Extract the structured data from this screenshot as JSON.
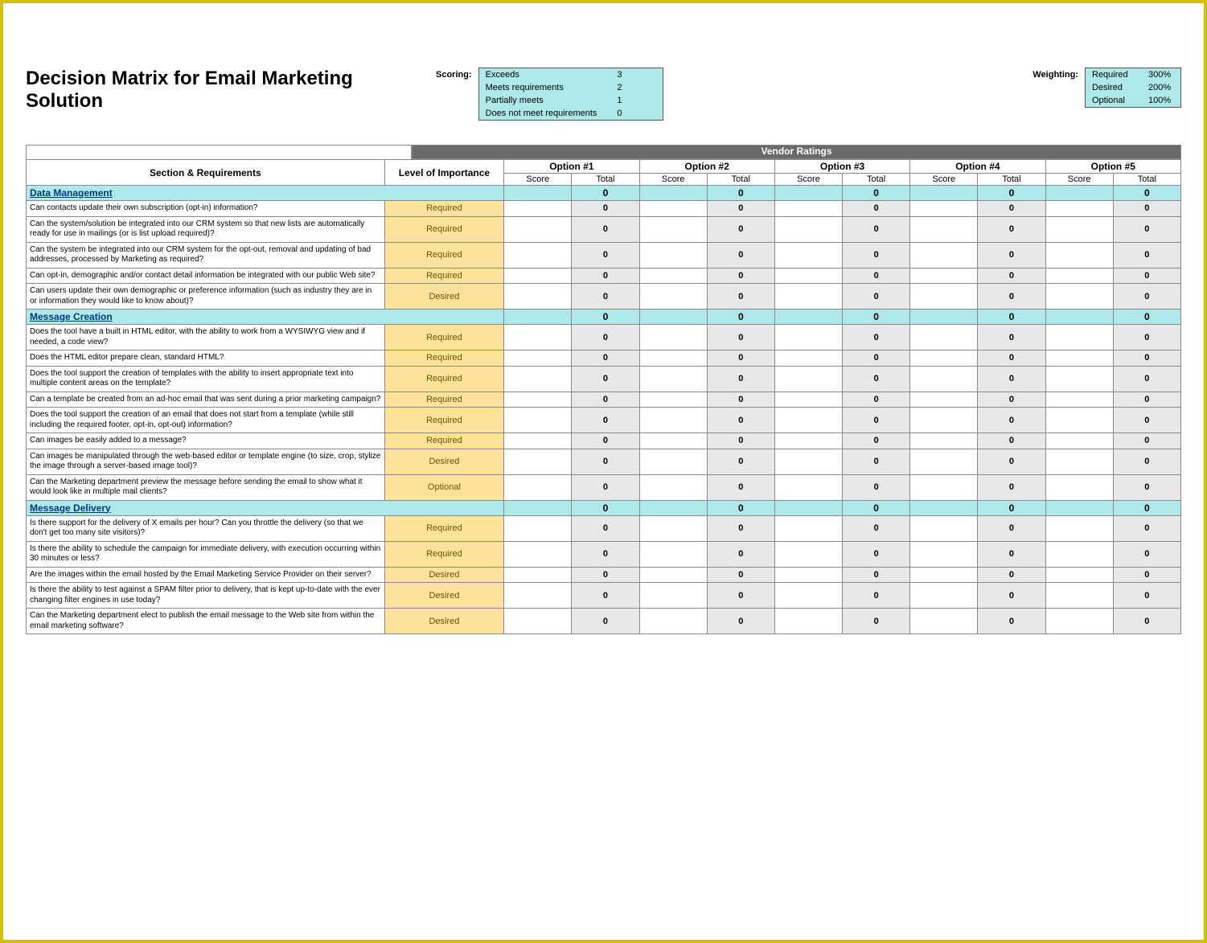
{
  "title": "Decision Matrix for Email Marketing Solution",
  "scoring": {
    "label": "Scoring:",
    "rows": [
      {
        "name": "Exceeds",
        "value": "3"
      },
      {
        "name": "Meets requirements",
        "value": "2"
      },
      {
        "name": "Partially meets",
        "value": "1"
      },
      {
        "name": "Does not meet requirements",
        "value": "0"
      }
    ]
  },
  "weighting": {
    "label": "Weighting:",
    "rows": [
      {
        "name": "Required",
        "value": "300%"
      },
      {
        "name": "Desired",
        "value": "200%"
      },
      {
        "name": "Optional",
        "value": "100%"
      }
    ]
  },
  "headers": {
    "vendorRatings": "Vendor Ratings",
    "sectionReq": "Section & Requirements",
    "level": "Level of Importance",
    "options": [
      "Option #1",
      "Option #2",
      "Option #3",
      "Option #4",
      "Option #5"
    ],
    "score": "Score",
    "total": "Total"
  },
  "sections": [
    {
      "name": "Data Management",
      "totals": [
        "0",
        "0",
        "0",
        "0",
        "0"
      ],
      "rows": [
        {
          "text": "Can contacts update their own subscription (opt-in) information?",
          "level": "Required",
          "totals": [
            "0",
            "0",
            "0",
            "0",
            "0"
          ]
        },
        {
          "text": "Can the system/solution be integrated into our CRM system so that new lists are automatically ready for use in mailings (or is list upload required)?",
          "level": "Required",
          "totals": [
            "0",
            "0",
            "0",
            "0",
            "0"
          ]
        },
        {
          "text": "Can the system be integrated into our CRM system for the opt-out, removal and updating of bad addresses, processed by Marketing as required?",
          "level": "Required",
          "totals": [
            "0",
            "0",
            "0",
            "0",
            "0"
          ]
        },
        {
          "text": "Can opt-in, demographic and/or contact detail information be integrated with our public Web site?",
          "level": "Required",
          "totals": [
            "0",
            "0",
            "0",
            "0",
            "0"
          ]
        },
        {
          "text": "Can users update their own demographic or preference information (such as industry they are in or information they would like to know about)?",
          "level": "Desired",
          "totals": [
            "0",
            "0",
            "0",
            "0",
            "0"
          ]
        }
      ]
    },
    {
      "name": "Message Creation",
      "totals": [
        "0",
        "0",
        "0",
        "0",
        "0"
      ],
      "rows": [
        {
          "text": "Does the tool have a built in HTML editor, with the ability to work from a WYSIWYG view and if needed, a code view?",
          "level": "Required",
          "totals": [
            "0",
            "0",
            "0",
            "0",
            "0"
          ]
        },
        {
          "text": "Does the HTML editor prepare clean, standard HTML?",
          "level": "Required",
          "totals": [
            "0",
            "0",
            "0",
            "0",
            "0"
          ]
        },
        {
          "text": "Does the tool support the creation of templates with the ability to insert appropriate text into multiple content areas on the template?",
          "level": "Required",
          "totals": [
            "0",
            "0",
            "0",
            "0",
            "0"
          ]
        },
        {
          "text": "Can a template be created from an ad-hoc email that was sent during a prior marketing campaign?",
          "level": "Required",
          "totals": [
            "0",
            "0",
            "0",
            "0",
            "0"
          ]
        },
        {
          "text": "Does the tool support the creation of an email that does not start from a template (while still including the required footer, opt-in, opt-out) information?",
          "level": "Required",
          "totals": [
            "0",
            "0",
            "0",
            "0",
            "0"
          ]
        },
        {
          "text": "Can images be easily added to a message?",
          "level": "Required",
          "totals": [
            "0",
            "0",
            "0",
            "0",
            "0"
          ]
        },
        {
          "text": "Can images be manipulated through the web-based editor or template engine (to size, crop, stylize the image through a server-based image tool)?",
          "level": "Desired",
          "totals": [
            "0",
            "0",
            "0",
            "0",
            "0"
          ]
        },
        {
          "text": "Can the Marketing department preview the message before sending the email to show what it would look like in multiple mail clients?",
          "level": "Optional",
          "totals": [
            "0",
            "0",
            "0",
            "0",
            "0"
          ]
        }
      ]
    },
    {
      "name": "Message Delivery",
      "totals": [
        "0",
        "0",
        "0",
        "0",
        "0"
      ],
      "rows": [
        {
          "text": "Is there support for the delivery of X emails per hour?  Can you throttle the delivery (so that we don't get too many site visitors)?",
          "level": "Required",
          "totals": [
            "0",
            "0",
            "0",
            "0",
            "0"
          ]
        },
        {
          "text": "Is there the ability to schedule the campaign for immediate delivery, with execution occurring within 30 minutes or less?",
          "level": "Required",
          "totals": [
            "0",
            "0",
            "0",
            "0",
            "0"
          ]
        },
        {
          "text": "Are the images within the email hosted by the Email Marketing Service Provider on their server?",
          "level": "Desired",
          "totals": [
            "0",
            "0",
            "0",
            "0",
            "0"
          ]
        },
        {
          "text": "Is there the ability to test against a SPAM filter prior to delivery, that is kept up-to-date with the ever changing filter engines in use today?",
          "level": "Desired",
          "totals": [
            "0",
            "0",
            "0",
            "0",
            "0"
          ]
        },
        {
          "text": "Can the Marketing department elect to publish the email message to the Web site from within the email marketing software?",
          "level": "Desired",
          "totals": [
            "0",
            "0",
            "0",
            "0",
            "0"
          ]
        }
      ]
    }
  ]
}
